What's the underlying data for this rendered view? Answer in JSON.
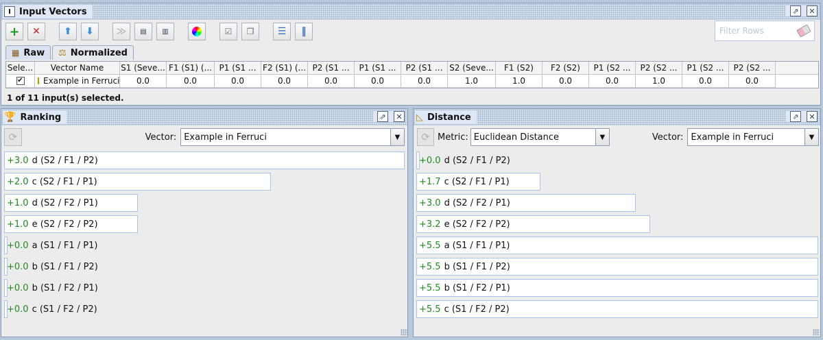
{
  "input_vectors": {
    "title": "Input Vectors",
    "filter_placeholder": "Filter Rows",
    "tabs": [
      {
        "label": "Raw",
        "active": true
      },
      {
        "label": "Normalized",
        "active": false
      }
    ],
    "table": {
      "columns": [
        "Sele...",
        "Vector Name",
        "S1 (Seve...",
        "F1 (S1) (...",
        "P1 (S1 ...",
        "F2 (S1) (...",
        "P2 (S1 ...",
        "P1 (S1 ...",
        "P2 (S1 ...",
        "S2 (Seve...",
        "F1 (S2)",
        "F2 (S2)",
        "P1 (S2 ...",
        "P2 (S2 ...",
        "P1 (S2 ...",
        "P2 (S2 ..."
      ],
      "rows": [
        {
          "checked": "✔",
          "name": "Example in Ferruci",
          "values": [
            "0.0",
            "0.0",
            "0.0",
            "0.0",
            "0.0",
            "0.0",
            "0.0",
            "1.0",
            "1.0",
            "0.0",
            "0.0",
            "1.0",
            "0.0",
            "0.0"
          ]
        }
      ]
    },
    "status": "1 of 11 input(s) selected."
  },
  "ranking": {
    "title": "Ranking",
    "vector_label": "Vector:",
    "vector_value": "Example in Ferruci",
    "max_value": 3.0,
    "items": [
      {
        "value": "+3.0",
        "label": "d (S2 / F1 / P2)",
        "num": 3.0
      },
      {
        "value": "+2.0",
        "label": "c (S2 / F1 / P1)",
        "num": 2.0
      },
      {
        "value": "+1.0",
        "label": "d (S2 / F2 / P1)",
        "num": 1.0
      },
      {
        "value": "+1.0",
        "label": "e (S2 / F2 / P2)",
        "num": 1.0
      },
      {
        "value": "+0.0",
        "label": "a (S1 / F1 / P1)",
        "num": 0.0
      },
      {
        "value": "+0.0",
        "label": "b (S1 / F1 / P2)",
        "num": 0.0
      },
      {
        "value": "+0.0",
        "label": "b (S1 / F2 / P1)",
        "num": 0.0
      },
      {
        "value": "+0.0",
        "label": "c (S1 / F2 / P2)",
        "num": 0.0
      }
    ]
  },
  "distance": {
    "title": "Distance",
    "metric_label": "Metric:",
    "metric_value": "Euclidean Distance",
    "vector_label": "Vector:",
    "vector_value": "Example in Ferruci",
    "max_value": 5.5,
    "items": [
      {
        "value": "+0.0",
        "label": "d (S2 / F1 / P2)",
        "num": 0.0
      },
      {
        "value": "+1.7",
        "label": "c (S2 / F1 / P1)",
        "num": 1.7
      },
      {
        "value": "+3.0",
        "label": "d (S2 / F2 / P1)",
        "num": 3.0
      },
      {
        "value": "+3.2",
        "label": "e (S2 / F2 / P2)",
        "num": 3.2
      },
      {
        "value": "+5.5",
        "label": "a (S1 / F1 / P1)",
        "num": 5.5
      },
      {
        "value": "+5.5",
        "label": "b (S1 / F1 / P2)",
        "num": 5.5
      },
      {
        "value": "+5.5",
        "label": "b (S1 / F2 / P1)",
        "num": 5.5
      },
      {
        "value": "+5.5",
        "label": "c (S1 / F2 / P2)",
        "num": 5.5
      }
    ]
  },
  "colors": {
    "positive_value": "#1e8a1e",
    "bar_border": "#a9c4e8",
    "accent": "#dfe8f4"
  }
}
